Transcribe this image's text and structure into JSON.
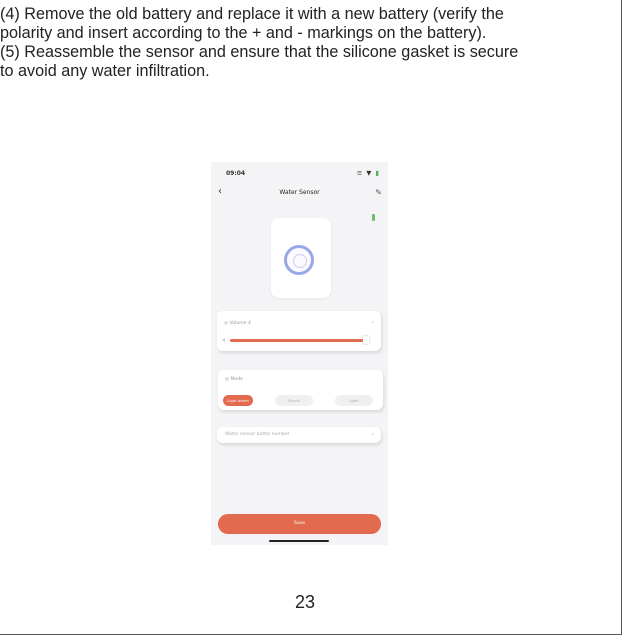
{
  "instructions": {
    "line1": "(4) Remove the old battery and replace it with a new battery (verify the",
    "line2": "polarity and insert according to the + and - markings on the battery).",
    "line3": "(5) Reassemble the sensor and ensure that the silicone gasket is secure",
    "line4": "to avoid any water infiltration."
  },
  "phone": {
    "status_time": "09:04",
    "status_icons": "≡ ▼",
    "status_battery": "▮",
    "back_icon": "‹",
    "title": "Water Sensor",
    "edit_icon": "✎",
    "volume_card": {
      "label": "◎ Volume 4",
      "chevron": "›",
      "slider_icon": "◁",
      "value": 0.92
    },
    "mode_card": {
      "label": "◎ Mode",
      "options": [
        "Light alarm",
        "Sound",
        "Light"
      ],
      "selected": 0
    },
    "detail_row": {
      "label": "Water sensor battle number",
      "chevron": "›"
    },
    "save_label": "Save"
  },
  "page_number": "23",
  "colors": {
    "accent": "#e26a4e",
    "device_ring": "#9aa7e6",
    "battery_green": "#6dc06d"
  }
}
